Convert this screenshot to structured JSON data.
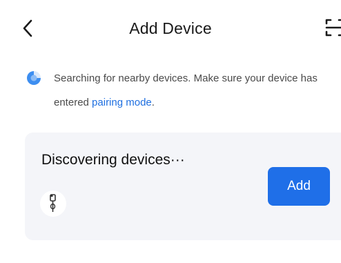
{
  "header": {
    "title": "Add Device",
    "back_icon": "chevron-left-icon",
    "scan_icon": "scan-icon"
  },
  "hint": {
    "spinner_icon": "loading-spinner-icon",
    "text_prefix": "Searching for nearby devices. Make sure your device has entered ",
    "link": "pairing mode",
    "text_suffix": "."
  },
  "discovery_card": {
    "title": "Discovering devices···",
    "device_icon": "stick-device-icon",
    "add_label": "Add"
  },
  "colors": {
    "accent": "#1f6fe8",
    "link": "#1f6fe0",
    "card_bg": "#f4f5f9",
    "text_primary": "#111111",
    "text_secondary": "#4a4a4a"
  }
}
